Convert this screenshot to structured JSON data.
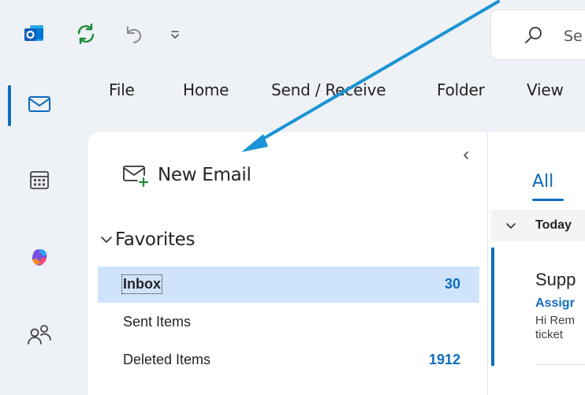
{
  "quick_access": {
    "app_icon": "outlook-logo",
    "sync_icon": "sync-icon",
    "undo_icon": "undo-icon",
    "customize_icon": "chevron-down-icon"
  },
  "search": {
    "visible_text": "Se"
  },
  "rail": {
    "items": [
      {
        "icon": "mail-icon",
        "active": true
      },
      {
        "icon": "calendar-icon",
        "active": false
      },
      {
        "icon": "copilot-icon",
        "active": false
      },
      {
        "icon": "people-icon",
        "active": false
      }
    ]
  },
  "ribbon": {
    "tabs": [
      {
        "label": "File"
      },
      {
        "label": "Home"
      },
      {
        "label": "Send / Receive"
      },
      {
        "label": "Folder"
      },
      {
        "label": "View"
      }
    ]
  },
  "folder_pane": {
    "new_email_label": "New Email",
    "favorites_label": "Favorites",
    "folders": [
      {
        "name": "Inbox",
        "count": "30",
        "selected": true
      },
      {
        "name": "Sent Items",
        "count": "",
        "selected": false
      },
      {
        "name": "Deleted Items",
        "count": "1912",
        "selected": false
      }
    ]
  },
  "message_list": {
    "filter_label": "All",
    "group_label": "Today",
    "message": {
      "sender": "Supp",
      "subject": "Assigr",
      "preview_line1": "Hi Rem",
      "preview_line2": "ticket"
    }
  },
  "colors": {
    "accent": "#0f6cbd",
    "selected_row": "#cfe4fa",
    "background": "#eef1f6",
    "annotation_arrow": "#1a94d4"
  }
}
